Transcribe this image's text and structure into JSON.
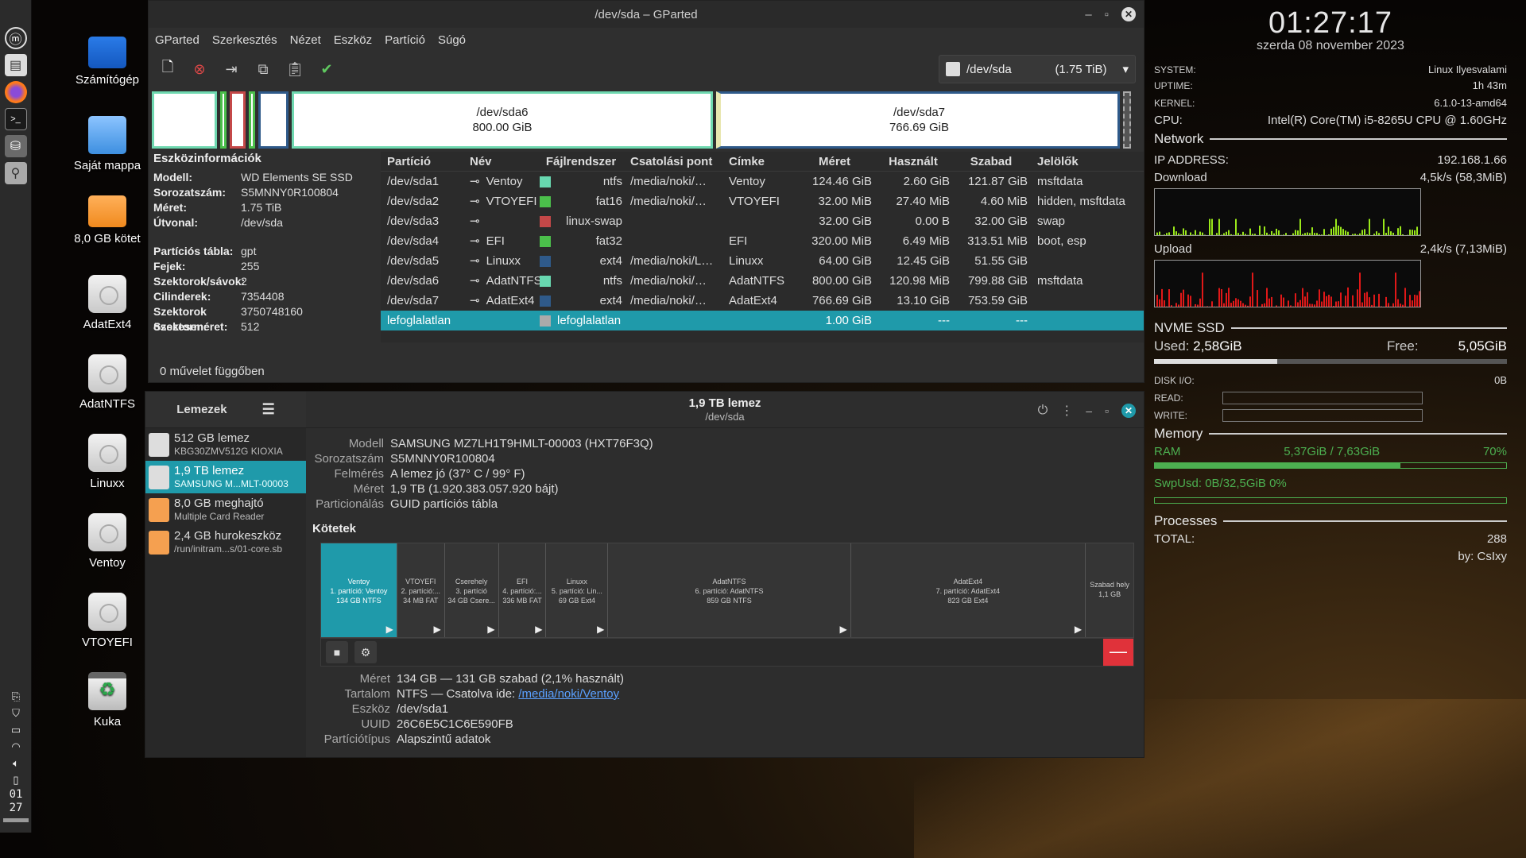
{
  "colors": {
    "accent": "#1f9aaa",
    "ntfs": "#68d8b0",
    "fat16": "#4bbf4b",
    "swap": "#c44848",
    "fat32": "#4bbf4b",
    "ext4": "#2f5a8a",
    "unalloc": "#aaaaaa",
    "upload": "#e01818",
    "download": "#9ae81a",
    "danger": "#e0323a"
  },
  "panel": {
    "icons": [
      "mint-menu-icon",
      "file-manager-icon",
      "firefox-icon",
      "terminal-icon",
      "gparted-icon",
      "disks-icon"
    ],
    "clock_h": "01",
    "clock_m": "27"
  },
  "desktop": [
    {
      "label": "Számítógép",
      "icon": "computer-icon"
    },
    {
      "label": "Saját mappa",
      "icon": "home-folder-icon"
    },
    {
      "label": "8,0 GB kötet",
      "icon": "usb-drive-icon"
    },
    {
      "label": "AdatExt4",
      "icon": "drive-icon"
    },
    {
      "label": "AdatNTFS",
      "icon": "drive-icon"
    },
    {
      "label": "Linuxx",
      "icon": "drive-icon"
    },
    {
      "label": "Ventoy",
      "icon": "drive-icon"
    },
    {
      "label": "VTOYEFI",
      "icon": "drive-icon"
    },
    {
      "label": "Kuka",
      "icon": "trash-icon"
    }
  ],
  "gparted": {
    "title": "/dev/sda – GParted",
    "menu": [
      "GParted",
      "Szerkesztés",
      "Nézet",
      "Eszköz",
      "Partíció",
      "Súgó"
    ],
    "device": "/dev/sda",
    "device_size": "(1.75 TiB)",
    "map": {
      "sda6": {
        "name": "/dev/sda6",
        "size": "800.00 GiB"
      },
      "sda7": {
        "name": "/dev/sda7",
        "size": "766.69 GiB"
      }
    },
    "info_title": "Eszközinformációk",
    "info1": [
      [
        "Modell:",
        "WD Elements SE SSD"
      ],
      [
        "Sorozatszám:",
        "S5MNNY0R100804"
      ],
      [
        "Méret:",
        "1.75 TiB"
      ],
      [
        "Útvonal:",
        "/dev/sda"
      ]
    ],
    "info2": [
      [
        "Partíciós tábla:",
        "gpt"
      ],
      [
        "Fejek:",
        "255"
      ],
      [
        "Szektorok/sávok:",
        "2"
      ],
      [
        "Cilinderek:",
        "7354408"
      ],
      [
        "Szektorok összesen:",
        "3750748160"
      ],
      [
        "Szektorméret:",
        "512"
      ]
    ],
    "headers": [
      "Partíció",
      "Név",
      "Fájlrendszer",
      "Csatolási pont",
      "Címke",
      "Méret",
      "Használt",
      "Szabad",
      "Jelölők"
    ],
    "rows": [
      [
        "/dev/sda1",
        "Ventoy",
        "ntfs",
        "/media/noki/…",
        "Ventoy",
        "124.46 GiB",
        "2.60 GiB",
        "121.87 GiB",
        "msftdata"
      ],
      [
        "/dev/sda2",
        "VTOYEFI",
        "fat16",
        "/media/noki/…",
        "VTOYEFI",
        "32.00 MiB",
        "27.40 MiB",
        "4.60 MiB",
        "hidden, msftdata"
      ],
      [
        "/dev/sda3",
        "",
        "linux-swap",
        "",
        "",
        "32.00 GiB",
        "0.00 B",
        "32.00 GiB",
        "swap"
      ],
      [
        "/dev/sda4",
        "EFI",
        "fat32",
        "",
        "EFI",
        "320.00 MiB",
        "6.49 MiB",
        "313.51 MiB",
        "boot, esp"
      ],
      [
        "/dev/sda5",
        "Linuxx",
        "ext4",
        "/media/noki/L…",
        "Linuxx",
        "64.00 GiB",
        "12.45 GiB",
        "51.55 GiB",
        ""
      ],
      [
        "/dev/sda6",
        "AdatNTFS",
        "ntfs",
        "/media/noki/…",
        "AdatNTFS",
        "800.00 GiB",
        "120.98 MiB",
        "799.88 GiB",
        "msftdata"
      ],
      [
        "/dev/sda7",
        "AdatExt4",
        "ext4",
        "/media/noki/…",
        "AdatExt4",
        "766.69 GiB",
        "13.10 GiB",
        "753.59 GiB",
        ""
      ],
      [
        "lefoglalatlan",
        "",
        "lefoglalatlan",
        "",
        "",
        "1.00 GiB",
        "---",
        "---",
        ""
      ]
    ],
    "status": "0 művelet függőben"
  },
  "disks": {
    "sidebar_title": "Lemezek",
    "title": "1,9 TB lemez",
    "subtitle": "/dev/sda",
    "list": [
      {
        "name": "512 GB lemez",
        "sub": "KBG30ZMV512G KIOXIA"
      },
      {
        "name": "1,9 TB lemez",
        "sub": "SAMSUNG M...MLT-00003"
      },
      {
        "name": "8,0 GB meghajtó",
        "sub": "Multiple Card  Reader"
      },
      {
        "name": "2,4 GB hurokeszköz",
        "sub": "/run/initram...s/01-core.sb"
      }
    ],
    "info": [
      [
        "Modell",
        "SAMSUNG MZ7LH1T9HMLT-00003 (HXT76F3Q)"
      ],
      [
        "Sorozatszám",
        "S5MNNY0R100804"
      ],
      [
        "Felmérés",
        "A lemez jó (37° C / 99° F)"
      ],
      [
        "Méret",
        "1,9 TB (1.920.383.057.920 bájt)"
      ],
      [
        "Particionálás",
        "GUID partíciós tábla"
      ]
    ],
    "volumes_title": "Kötetek",
    "volumes": [
      {
        "l1": "Ventoy",
        "l2": "1. partíció: Ventoy",
        "l3": "134 GB NTFS"
      },
      {
        "l1": "VTOYEFI",
        "l2": "2. partíció:...",
        "l3": "34 MB FAT"
      },
      {
        "l1": "Cserehely",
        "l2": "3. partíció",
        "l3": "34 GB Csere..."
      },
      {
        "l1": "EFI",
        "l2": "4. partíció:...",
        "l3": "336 MB FAT"
      },
      {
        "l1": "Linuxx",
        "l2": "5. partíció: Lin...",
        "l3": "69 GB Ext4"
      },
      {
        "l1": "AdatNTFS",
        "l2": "6. partíció: AdatNTFS",
        "l3": "859 GB NTFS"
      },
      {
        "l1": "AdatExt4",
        "l2": "7. partíció: AdatExt4",
        "l3": "823 GB Ext4"
      },
      {
        "l1": "Szabad hely",
        "l2": "1,1 GB",
        "l3": ""
      }
    ],
    "details": [
      [
        "Méret",
        "134 GB — 131 GB szabad (2,1% használt)"
      ],
      [
        "Tartalom",
        "NTFS — Csatolva ide: "
      ],
      [
        "Eszköz",
        "/dev/sda1"
      ],
      [
        "UUID",
        "26C6E5C1C6E590FB"
      ],
      [
        "Partíciótípus",
        "Alapszintű adatok"
      ]
    ],
    "mount_link": "/media/noki/Ventoy"
  },
  "conky": {
    "time": "01:27:17",
    "date": "szerda 08 november 2023",
    "system": [
      "SYSTEM:",
      "Linux Ilyesvalami"
    ],
    "uptime": [
      "UPTIME:",
      "1h 43m"
    ],
    "kernel": [
      "KERNEL:",
      "6.1.0-13-amd64"
    ],
    "cpu": [
      "CPU:",
      "Intel(R) Core(TM) i5-8265U CPU @ 1.60GHz"
    ],
    "network": "Network",
    "ip": [
      "IP ADDRESS:",
      "192.168.1.66"
    ],
    "download": [
      "Download",
      "4,5k/s (58,3MiB)"
    ],
    "upload": [
      "Upload",
      "2,4k/s (7,13MiB)"
    ],
    "nvme": "NVME SSD",
    "used_label": "Used:",
    "used": "2,58GiB",
    "free_label": "Free:",
    "free": "5,05GiB",
    "used_fraction": 0.35,
    "diskio": [
      "DISK I/O:",
      "0B"
    ],
    "read": "READ:",
    "write": "WRITE:",
    "memory": "Memory",
    "ram_label": "RAM",
    "ram": "5,37GiB / 7,63GiB",
    "ram_pct": "70%",
    "ram_fraction": 0.7,
    "swap": "SwpUsd: 0B/32,5GiB 0%",
    "swap_fraction": 0.0,
    "processes": "Processes",
    "total": [
      "TOTAL:",
      "288"
    ],
    "by": "by: CsIxy"
  }
}
